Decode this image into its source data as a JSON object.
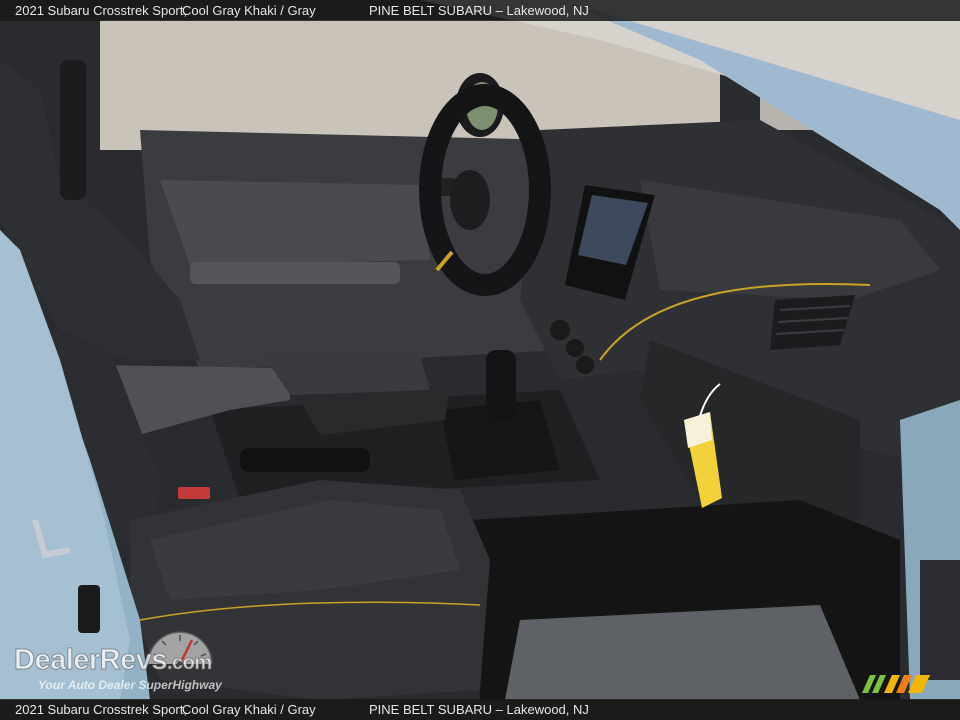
{
  "caption": {
    "vehicle": "2021 Subaru Crosstrek Sport,",
    "colors": "Cool Gray Khaki / Gray",
    "dealer": "PINE BELT SUBARU – Lakewood, NJ"
  },
  "watermark": {
    "brand": "DealerRevs",
    "brand_suffix": ".com",
    "tagline": "Your Auto Dealer SuperHighway"
  },
  "icons": {
    "gauge": "speedometer-icon",
    "corner_logo": "stripes-logo"
  },
  "colors": {
    "body_paint": "#8fb0c4",
    "accent_stitch": "#c9a227",
    "tag_yellow": "#f1d23a"
  }
}
